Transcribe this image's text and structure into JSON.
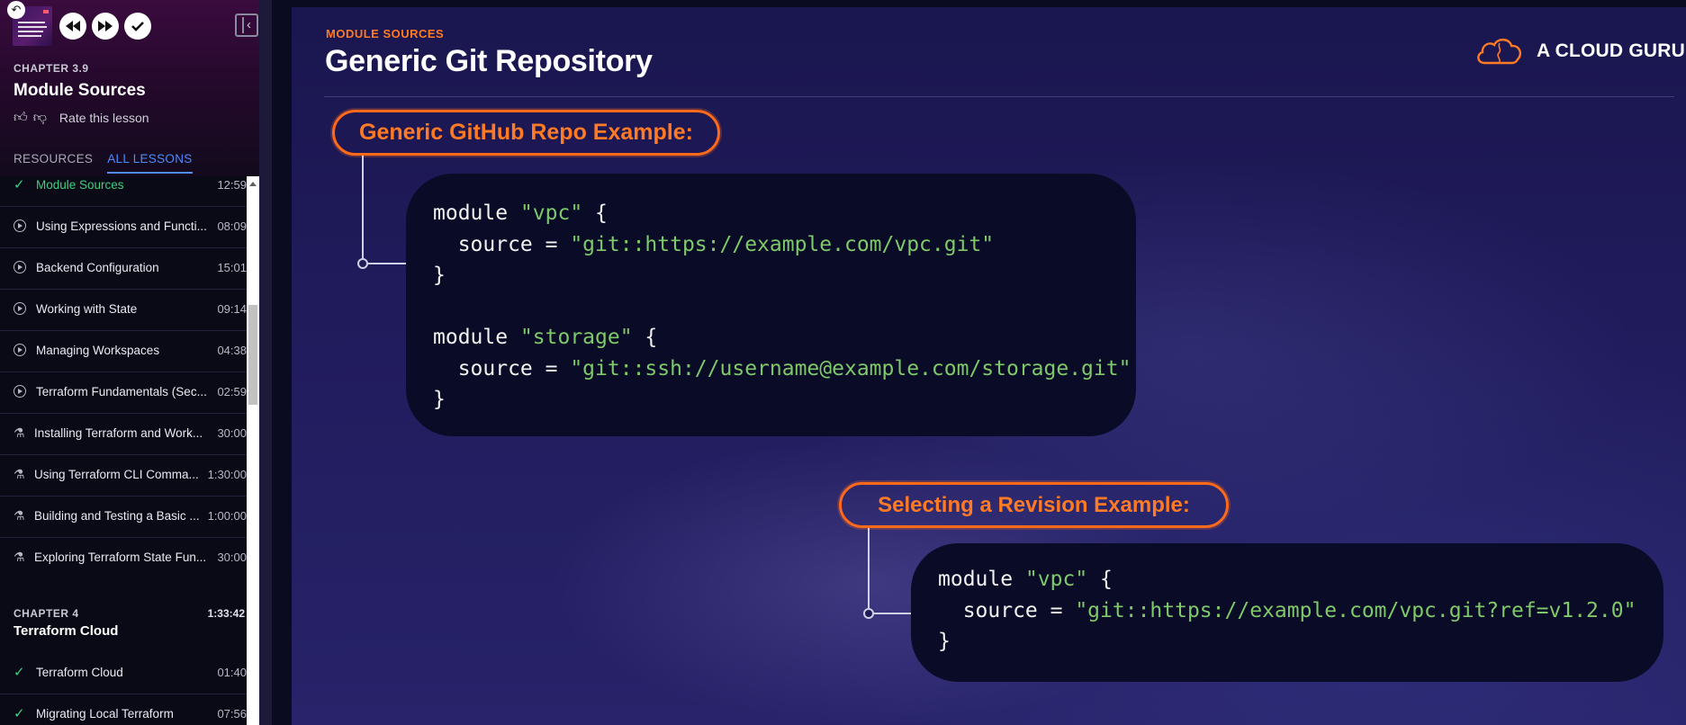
{
  "sidebar": {
    "chapter_label": "CHAPTER 3.9",
    "chapter_title": "Module Sources",
    "rate_text": "Rate this lesson",
    "tabs": [
      "RESOURCES",
      "ALL LESSONS"
    ],
    "lessons": [
      {
        "icon": "check",
        "name": "Module Sources",
        "duration": "12:59",
        "current": true
      },
      {
        "icon": "play",
        "name": "Using Expressions and Functi...",
        "duration": "08:09"
      },
      {
        "icon": "play",
        "name": "Backend Configuration",
        "duration": "15:01"
      },
      {
        "icon": "play",
        "name": "Working with State",
        "duration": "09:14"
      },
      {
        "icon": "play",
        "name": "Managing Workspaces",
        "duration": "04:38"
      },
      {
        "icon": "play",
        "name": "Terraform Fundamentals (Sec...",
        "duration": "02:59"
      },
      {
        "icon": "lab",
        "name": "Installing Terraform and Work...",
        "duration": "30:00"
      },
      {
        "icon": "lab",
        "name": "Using Terraform CLI Comma...",
        "duration": "1:30:00"
      },
      {
        "icon": "lab",
        "name": "Building and Testing a Basic ...",
        "duration": "1:00:00"
      },
      {
        "icon": "lab",
        "name": "Exploring Terraform State Fun...",
        "duration": "30:00"
      }
    ],
    "chapter4": {
      "label": "CHAPTER 4",
      "title": "Terraform Cloud",
      "duration": "1:33:42",
      "lessons": [
        {
          "icon": "check",
          "name": "Terraform Cloud",
          "duration": "01:40"
        },
        {
          "icon": "check",
          "name": "Migrating Local Terraform",
          "duration": "07:56"
        }
      ]
    }
  },
  "slide": {
    "module_label": "MODULE SOURCES",
    "title": "Generic Git Repository",
    "brand": "A CLOUD GURU",
    "callout1": "Generic GitHub Repo Example:",
    "callout2": "Selecting a Revision Example:",
    "code1": {
      "l1_a": "module ",
      "l1_s": "\"vpc\"",
      "l1_b": " {",
      "l2_a": "  source = ",
      "l2_s": "\"git::https://example.com/vpc.git\"",
      "l3": "}",
      "l5_a": "module ",
      "l5_s": "\"storage\"",
      "l5_b": " {",
      "l6_a": "  source = ",
      "l6_s": "\"git::ssh://username@example.com/storage.git\"",
      "l7": "}"
    },
    "code2": {
      "l1_a": "module ",
      "l1_s": "\"vpc\"",
      "l1_b": " {",
      "l2_a": "  source = ",
      "l2_s": "\"git::https://example.com/vpc.git?ref=v1.2.0\"",
      "l3": "}"
    }
  },
  "colors": {
    "accent_orange": "#ff7a24",
    "link_blue": "#4d8bff",
    "check_green": "#3fcf82",
    "code_string": "#7ec96a"
  }
}
